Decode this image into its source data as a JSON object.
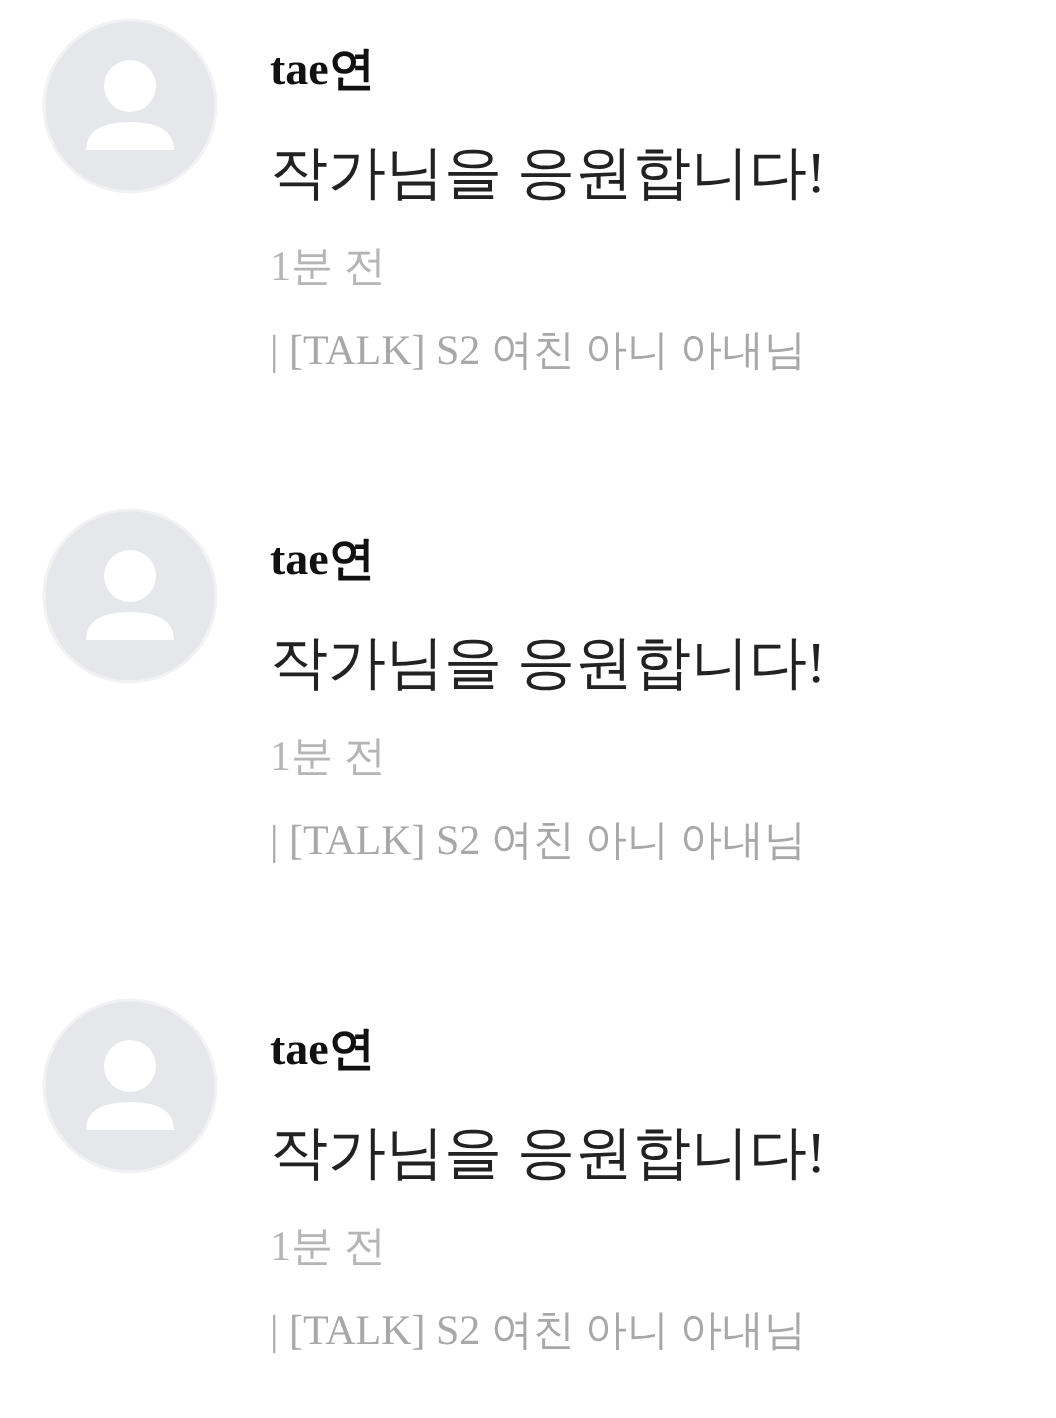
{
  "comments": [
    {
      "author": "tae연",
      "text": "작가님을 응원합니다!",
      "time": "1분 전",
      "source": "| [TALK] S2 여친 아니 아내님"
    },
    {
      "author": "tae연",
      "text": "작가님을 응원합니다!",
      "time": "1분 전",
      "source": "| [TALK] S2 여친 아니 아내님"
    },
    {
      "author": "tae연",
      "text": "작가님을 응원합니다!",
      "time": "1분 전",
      "source": "| [TALK] S2 여친 아니 아내님"
    }
  ]
}
